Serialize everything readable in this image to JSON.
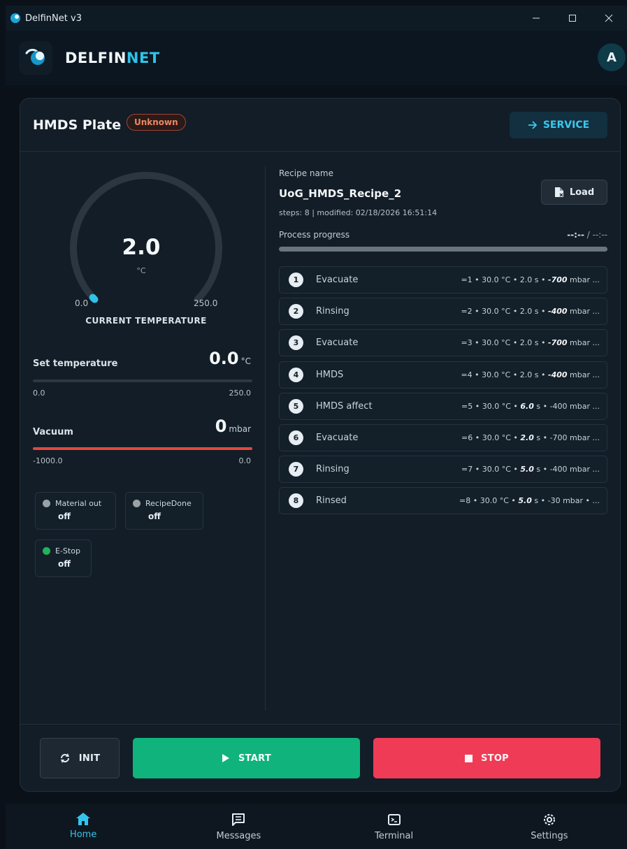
{
  "window": {
    "title": "DelfinNet v3",
    "controls": [
      "minimize",
      "maximize",
      "close"
    ]
  },
  "header": {
    "brand_part1": "DELFIN",
    "brand_part2": "NET",
    "avatar_initial": "A",
    "brand_colors": {
      "primary": "#f2f6f8",
      "accent": "#2ec3ea"
    }
  },
  "device": {
    "name": "HMDS Plate",
    "status": "Unknown",
    "status_color": "#ee8660",
    "service_label": "SERVICE"
  },
  "gauge": {
    "value": "2.0",
    "unit": "°C",
    "min": "0.0",
    "max": "250.0",
    "caption": "CURRENT TEMPERATURE",
    "current_numeric": 2.0,
    "min_numeric": 0.0,
    "max_numeric": 250.0,
    "color": "#2ec3ea"
  },
  "set_temperature": {
    "label": "Set temperature",
    "value": "0.0",
    "unit": "°C",
    "min": "0.0",
    "max": "250.0",
    "fraction": 0.0
  },
  "vacuum": {
    "label": "Vacuum",
    "value": "0",
    "unit": "mbar",
    "min": "-1000.0",
    "max": "0.0",
    "fraction": 1.0,
    "color": "#e5473d"
  },
  "io": [
    {
      "name": "Material out",
      "value": "off",
      "dot_color": "#9aa2a8"
    },
    {
      "name": "RecipeDone",
      "value": "off",
      "dot_color": "#9aa2a8"
    },
    {
      "name": "E-Stop",
      "value": "off",
      "dot_color": "#22b35a"
    }
  ],
  "recipe": {
    "caption": "Recipe name",
    "name": "UoG_HMDS_Recipe_2",
    "meta": "steps: 8 | modified: 02/18/2026 16:51:14",
    "load_label": "Load",
    "progress_label": "Process progress",
    "progress_elapsed": "--:--",
    "progress_separator": " / ",
    "progress_total": "--:--",
    "progress_fraction": 0.0
  },
  "steps": [
    {
      "num": "1",
      "name": "Evacuate",
      "pre": "=1 • 30.0 °C • 2.0 s • ",
      "em": "-700",
      "post": " mbar ..."
    },
    {
      "num": "2",
      "name": "Rinsing",
      "pre": "=2 • 30.0 °C • 2.0 s • ",
      "em": "-400",
      "post": " mbar ..."
    },
    {
      "num": "3",
      "name": "Evacuate",
      "pre": "=3 • 30.0 °C • 2.0 s • ",
      "em": "-700",
      "post": " mbar ..."
    },
    {
      "num": "4",
      "name": "HMDS",
      "pre": "=4 • 30.0 °C • 2.0 s • ",
      "em": "-400",
      "post": " mbar ..."
    },
    {
      "num": "5",
      "name": "HMDS affect",
      "pre": "=5 • 30.0 °C • ",
      "em": "6.0",
      "post": " s • -400 mbar ..."
    },
    {
      "num": "6",
      "name": "Evacuate",
      "pre": "=6 • 30.0 °C • ",
      "em": "2.0",
      "post": " s • -700 mbar ..."
    },
    {
      "num": "7",
      "name": "Rinsing",
      "pre": "=7 • 30.0 °C • ",
      "em": "5.0",
      "post": " s • -400 mbar ..."
    },
    {
      "num": "8",
      "name": "Rinsed",
      "pre": "=8 • 30.0 °C • ",
      "em": "5.0",
      "post": " s • -30 mbar • ..."
    }
  ],
  "actions": {
    "init_label": "INIT",
    "start_label": "START",
    "stop_label": "STOP",
    "start_color": "#10b37c",
    "stop_color": "#ef3b55"
  },
  "nav": [
    {
      "label": "Home",
      "icon": "home-icon",
      "active": true
    },
    {
      "label": "Messages",
      "icon": "messages-icon",
      "active": false
    },
    {
      "label": "Terminal",
      "icon": "terminal-icon",
      "active": false
    },
    {
      "label": "Settings",
      "icon": "gear-icon",
      "active": false
    }
  ]
}
